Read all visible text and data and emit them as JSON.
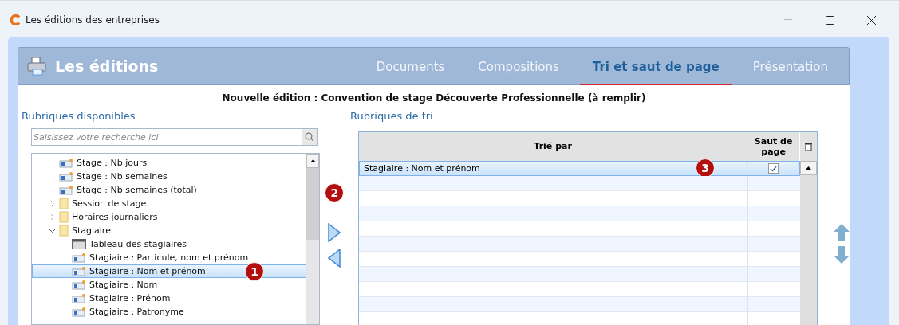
{
  "window": {
    "title": "Les éditions des entreprises"
  },
  "header": {
    "title": "Les éditions"
  },
  "tabs": [
    {
      "label": "Documents",
      "selected": false
    },
    {
      "label": "Compositions",
      "selected": false
    },
    {
      "label": "Tri et saut de page",
      "selected": true
    },
    {
      "label": "Présentation",
      "selected": false
    }
  ],
  "edition_title": "Nouvelle édition : Convention de stage Découverte Professionnelle (à remplir)",
  "available": {
    "legend": "Rubriques disponibles",
    "search": {
      "placeholder": "Saisissez votre recherche ici"
    },
    "tree": [
      {
        "kind": "field",
        "label": "Stage : Nb jours",
        "selected": false
      },
      {
        "kind": "field",
        "label": "Stage : Nb semaines",
        "selected": false
      },
      {
        "kind": "field",
        "label": "Stage : Nb semaines (total)",
        "selected": false
      },
      {
        "kind": "folder",
        "label": "Session de stage",
        "expanded": false,
        "selected": false
      },
      {
        "kind": "folder",
        "label": "Horaires journaliers",
        "expanded": false,
        "selected": false
      },
      {
        "kind": "folder",
        "label": "Stagiaire",
        "expanded": true,
        "selected": false,
        "children": [
          {
            "kind": "table",
            "label": "Tableau des stagiaires",
            "selected": false
          },
          {
            "kind": "field",
            "label": "Stagiaire : Particule, nom et prénom",
            "selected": false
          },
          {
            "kind": "field",
            "label": "Stagiaire : Nom et prénom",
            "selected": true,
            "callout": "1"
          },
          {
            "kind": "field",
            "label": "Stagiaire : Nom",
            "selected": false
          },
          {
            "kind": "field",
            "label": "Stagiaire : Prénom",
            "selected": false
          },
          {
            "kind": "field",
            "label": "Stagiaire : Patronyme",
            "selected": false
          }
        ]
      }
    ]
  },
  "transfer_callout": "2",
  "sort": {
    "legend": "Rubriques de tri",
    "columns": [
      "Trié par",
      "Saut de\npage"
    ],
    "rows": [
      {
        "label": "Stagiaire : Nom et prénom",
        "page_break": true,
        "selected": true,
        "callout": "3"
      }
    ]
  }
}
